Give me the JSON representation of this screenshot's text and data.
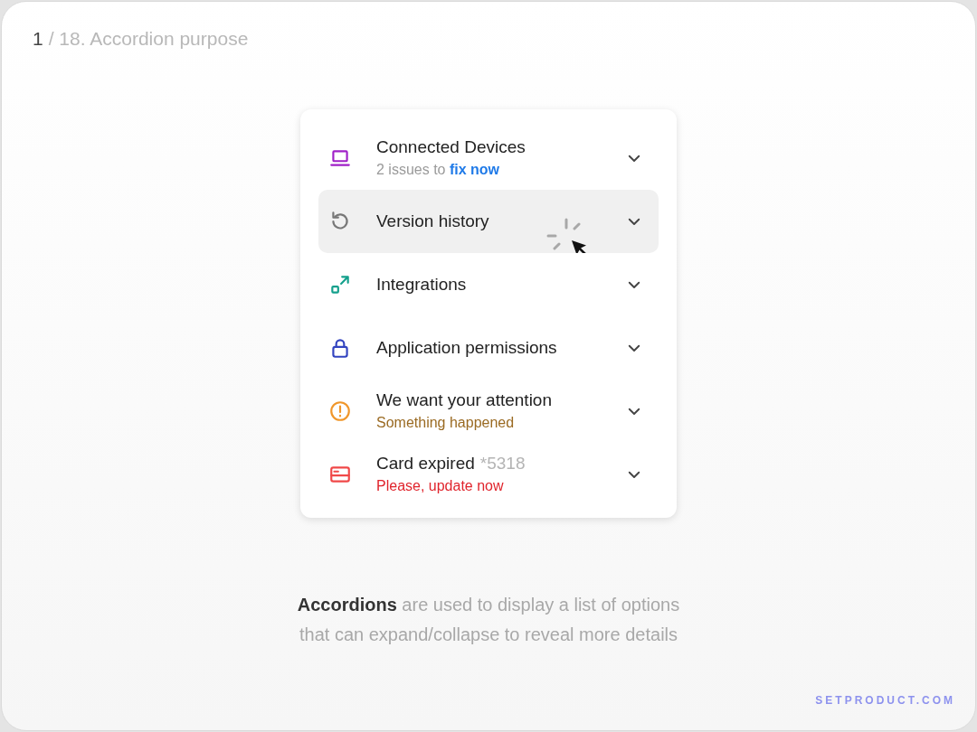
{
  "header": {
    "page_number": "1",
    "title": "/ 18. Accordion purpose"
  },
  "accordion": {
    "items": [
      {
        "kind": "laptop",
        "color": "#a020c8",
        "title": "Connected Devices",
        "subtitle": {
          "text": "2 issues to **fix now**",
          "color": "#9a9a9a"
        },
        "hovered": false
      },
      {
        "kind": "history",
        "color": "#777777",
        "title": "Version history",
        "hovered": true
      },
      {
        "kind": "integration",
        "color": "#14a08c",
        "title": "Integrations",
        "hovered": false
      },
      {
        "kind": "lock",
        "color": "#3344c0",
        "title": "Application permissions",
        "hovered": false
      },
      {
        "kind": "alert",
        "color": "#f0962a",
        "title": "We want your attention",
        "subtitle": {
          "text": "Something happened",
          "color": "#9a6a22"
        },
        "hovered": false
      },
      {
        "kind": "card",
        "color": "#f04848",
        "title": "Card expired",
        "title_suffix": "*5318",
        "subtitle": {
          "text": "Please, update now",
          "color": "#e0242c"
        },
        "hovered": false
      }
    ]
  },
  "caption": [
    "**Accordions** are used to display a list of options",
    "that can expand/collapse to reveal more details"
  ],
  "footer": {
    "brand": "SETPRODUCT.COM"
  }
}
